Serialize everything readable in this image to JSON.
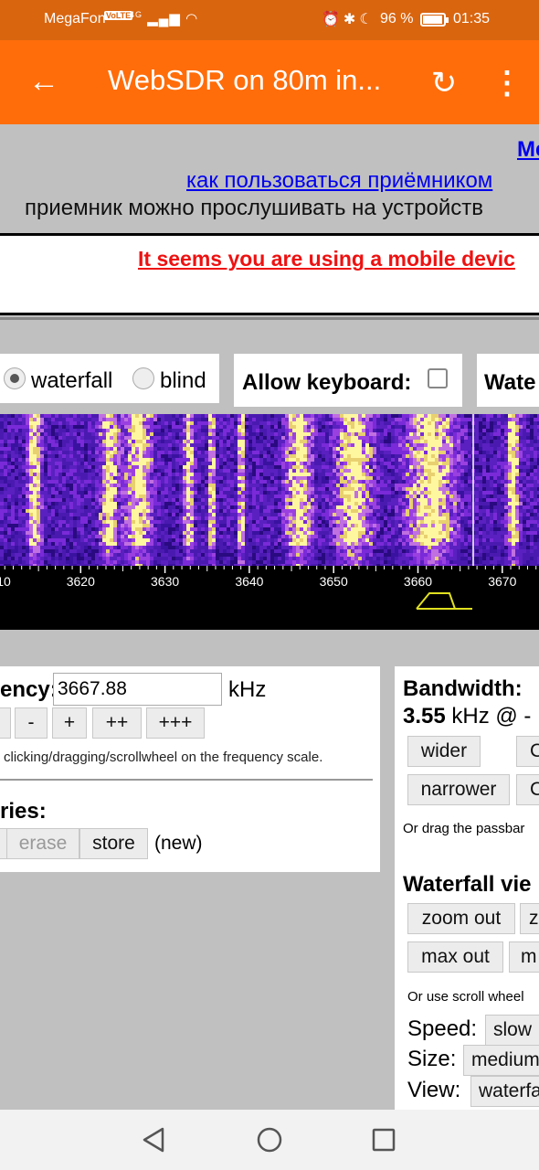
{
  "status_bar": {
    "carrier": "MegaFon",
    "volte": "VoLTE",
    "net": "4G",
    "battery_pct": "96 %",
    "battery_level": 0.96,
    "time": "01:35"
  },
  "app_bar": {
    "title": "WebSDR on 80m in..."
  },
  "page": {
    "line1": "Me",
    "line2": "как пользоваться приёмником",
    "line3": "приемник можно прослушивать на устройств",
    "mobile_warning": "It seems you are using a mobile devic",
    "view_panel": {
      "waterfall": "waterfall",
      "blind": "blind"
    },
    "keyboard_panel": {
      "label": "Allow keyboard:"
    },
    "third_panel": {
      "label": "Wate"
    },
    "scale": {
      "ticks": [
        "10",
        "3620",
        "3630",
        "3640",
        "3650",
        "3660",
        "3670"
      ]
    },
    "frequency": {
      "label": "ency:",
      "value": "3667.88",
      "unit": "kHz",
      "buttons": [
        "-",
        "+",
        "++",
        "+++"
      ],
      "hint": "clicking/dragging/scrollwheel on the frequency scale."
    },
    "memories": {
      "label": "ries:",
      "erase": "erase",
      "store": "store",
      "new": "(new)"
    },
    "bandwidth": {
      "title": "Bandwidth:",
      "value": "3.55",
      "unit": "kHz @ -",
      "wider": "wider",
      "narrower": "narrower",
      "btn_c1": "C",
      "btn_c2": "C",
      "hint": "Or drag the passbar"
    },
    "waterfall_view": {
      "title": "Waterfall vie",
      "zoom_out": "zoom out",
      "zoom_partial": "z",
      "max_out": "max out",
      "max_partial": "m",
      "hint": "Or use scroll wheel",
      "speed_label": "Speed:",
      "speed_value": "slow",
      "size_label": "Size:",
      "size_value": "medium",
      "view_label": "View:",
      "view_value": "waterfa"
    }
  }
}
